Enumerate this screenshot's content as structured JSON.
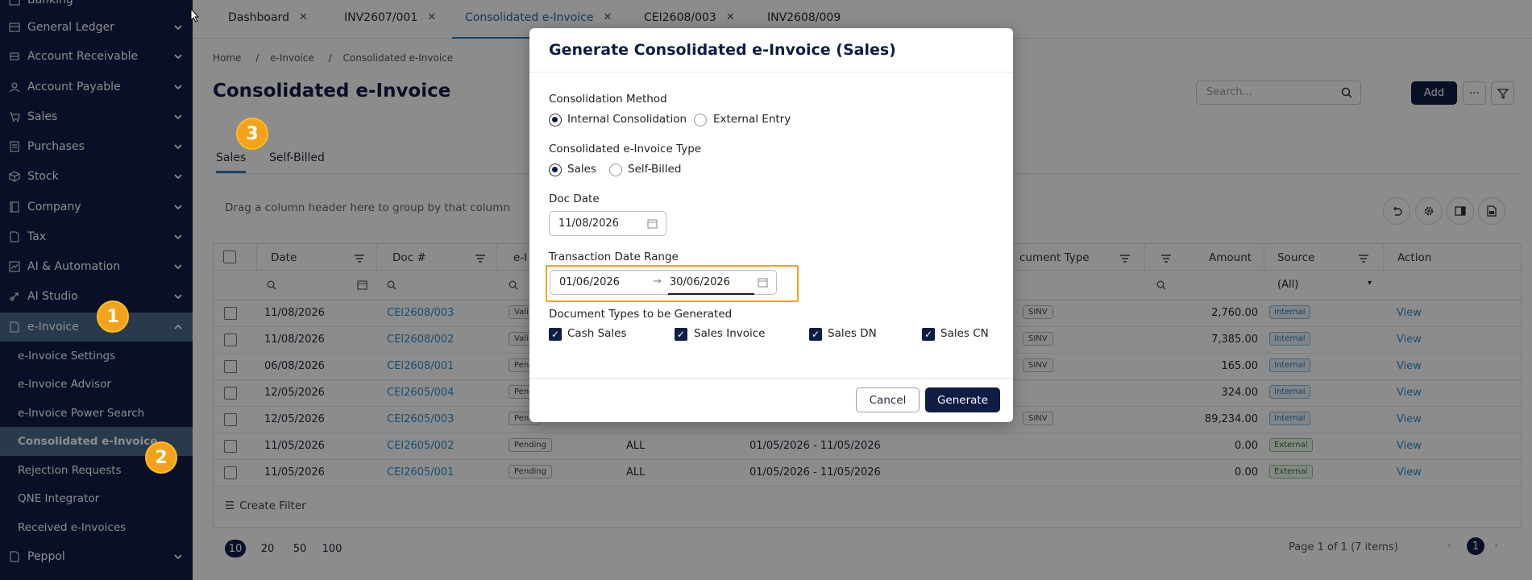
{
  "sidebar": {
    "items": [
      {
        "label": "Banking",
        "icon": "bank-icon"
      },
      {
        "label": "General Ledger",
        "icon": "ledger-icon"
      },
      {
        "label": "Account Receivable",
        "icon": "receivable-icon"
      },
      {
        "label": "Account Payable",
        "icon": "user-icon"
      },
      {
        "label": "Sales",
        "icon": "cart-icon"
      },
      {
        "label": "Purchases",
        "icon": "receipt-icon"
      },
      {
        "label": "Stock",
        "icon": "cube-icon"
      },
      {
        "label": "Company",
        "icon": "book-icon"
      },
      {
        "label": "Tax",
        "icon": "document-icon"
      },
      {
        "label": "AI & Automation",
        "icon": "chart-icon"
      },
      {
        "label": "AI Studio",
        "icon": "rocket-icon"
      },
      {
        "label": "e-Invoice",
        "icon": "file-icon"
      }
    ],
    "einvoice_sub": [
      "e-Invoice Settings",
      "e-Invoice Advisor",
      "e-Invoice Power Search",
      "Consolidated e-Invoice",
      "Rejection Requests",
      "QNE Integrator",
      "Received e-Invoices"
    ],
    "peppol_label": "Peppol"
  },
  "tabs": [
    {
      "label": "Dashboard"
    },
    {
      "label": "INV2607/001"
    },
    {
      "label": "Consolidated e-Invoice"
    },
    {
      "label": "CEI2608/003"
    },
    {
      "label": "INV2608/009"
    }
  ],
  "breadcrumb": {
    "home": "Home",
    "sep": "/",
    "section": "e-Invoice",
    "current": "Consolidated e-Invoice"
  },
  "page_title": "Consolidated e-Invoice",
  "search": {
    "placeholder": "Search..."
  },
  "toolbar": {
    "add_label": "Add"
  },
  "subtabs": {
    "sales": "Sales",
    "self_billed": "Self-Billed"
  },
  "grid": {
    "group_hint": "Drag a column header here to group by that column",
    "headers": {
      "date": "Date",
      "doc": "Doc #",
      "einv": "e-I",
      "doctype": "cument Type",
      "amount": "Amount",
      "source": "Source",
      "action": "Action"
    },
    "source_filter": "(All)",
    "rows": [
      {
        "date": "11/08/2026",
        "doc": "CEI2608/003",
        "status": "Vali",
        "type": "",
        "range": "",
        "doctype": "SINV",
        "amount": "2,760.00",
        "source": "Internal",
        "action": "View"
      },
      {
        "date": "11/08/2026",
        "doc": "CEI2608/002",
        "status": "Vali",
        "type": "",
        "range": "",
        "doctype": "SINV",
        "amount": "7,385.00",
        "source": "Internal",
        "action": "View"
      },
      {
        "date": "06/08/2026",
        "doc": "CEI2608/001",
        "status": "Pend",
        "type": "",
        "range": "",
        "doctype": "SINV",
        "amount": "165.00",
        "source": "Internal",
        "action": "View"
      },
      {
        "date": "12/05/2026",
        "doc": "CEI2605/004",
        "status": "Pend",
        "type": "",
        "range": "",
        "doctype": "",
        "amount": "324.00",
        "source": "Internal",
        "action": "View"
      },
      {
        "date": "12/05/2026",
        "doc": "CEI2605/003",
        "status": "Pend",
        "type": "",
        "range": "",
        "doctype": "SINV",
        "amount": "89,234.00",
        "source": "Internal",
        "action": "View"
      },
      {
        "date": "11/05/2026",
        "doc": "CEI2605/002",
        "status": "Pending",
        "type": "ALL",
        "range": "01/05/2026 - 11/05/2026",
        "doctype": "",
        "amount": "0.00",
        "source": "External",
        "action": "View"
      },
      {
        "date": "11/05/2026",
        "doc": "CEI2605/001",
        "status": "Pending",
        "type": "ALL",
        "range": "01/05/2026 - 11/05/2026",
        "doctype": "",
        "amount": "0.00",
        "source": "External",
        "action": "View"
      }
    ],
    "create_filter": "Create Filter"
  },
  "pager": {
    "sizes": [
      "10",
      "20",
      "50",
      "100"
    ],
    "info": "Page 1 of 1 (7 items)",
    "current": "1"
  },
  "modal": {
    "title": "Generate Consolidated e-Invoice (Sales)",
    "method_label": "Consolidation Method",
    "method_internal": "Internal Consolidation",
    "method_external": "External Entry",
    "type_label": "Consolidated e-Invoice Type",
    "type_sales": "Sales",
    "type_self": "Self-Billed",
    "doc_date_label": "Doc Date",
    "doc_date": "11/08/2026",
    "range_label": "Transaction Date Range",
    "range_from": "01/06/2026",
    "range_arrow": "→",
    "range_to": "30/06/2026",
    "doctypes_label": "Document Types to be Generated",
    "doctypes": [
      "Cash Sales",
      "Sales Invoice",
      "Sales DN",
      "Sales CN"
    ],
    "cancel": "Cancel",
    "generate": "Generate"
  },
  "steps": [
    "1",
    "2",
    "3"
  ],
  "colors": {
    "sidebar_bg": "#0f1c45",
    "accent": "#f4a21a",
    "link": "#2b8fd6"
  }
}
